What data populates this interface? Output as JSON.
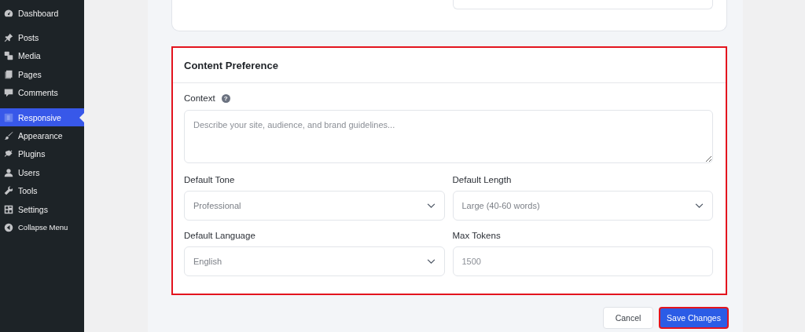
{
  "sidebar": {
    "groups": [
      {
        "items": [
          {
            "label": "Dashboard",
            "selected": false
          }
        ]
      },
      {
        "items": [
          {
            "label": "Posts",
            "selected": false
          },
          {
            "label": "Media",
            "selected": false
          },
          {
            "label": "Pages",
            "selected": false
          },
          {
            "label": "Comments",
            "selected": false
          }
        ]
      },
      {
        "items": [
          {
            "label": "Responsive",
            "selected": true
          },
          {
            "label": "Appearance",
            "selected": false
          },
          {
            "label": "Plugins",
            "selected": false
          },
          {
            "label": "Users",
            "selected": false
          },
          {
            "label": "Tools",
            "selected": false
          },
          {
            "label": "Settings",
            "selected": false
          },
          {
            "label": "Collapse Menu",
            "selected": false
          }
        ]
      }
    ]
  },
  "previous_card": {
    "fields": [
      {
        "kind": "input"
      }
    ]
  },
  "section": {
    "title": "Content Preference",
    "highlighted": true,
    "context": {
      "label": "Context",
      "help": "?",
      "placeholder": "Describe your site, audience, and brand guidelines..."
    },
    "fields": [
      {
        "kind": "select",
        "label": "Default Tone",
        "value": "Professional"
      },
      {
        "kind": "select",
        "label": "Default Length",
        "value": "Large (40-60 words)"
      },
      {
        "kind": "select",
        "label": "Default Language",
        "value": "English"
      },
      {
        "kind": "input",
        "label": "Max Tokens",
        "placeholder": "1500"
      }
    ]
  },
  "buttons": [
    {
      "label": "Cancel",
      "kind": "secondary",
      "highlighted": false
    },
    {
      "label": "Save Changes",
      "kind": "primary",
      "highlighted": true
    }
  ]
}
